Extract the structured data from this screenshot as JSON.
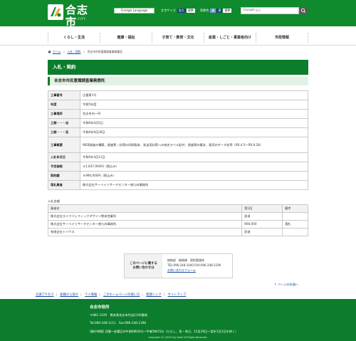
{
  "header": {
    "logo_name": "合志市",
    "logo_sub": "KOSHI CITY",
    "lang_button": "Foreign Language",
    "font_size_label": "文字サイズ",
    "font_enlarge": "拡大",
    "font_standard": "標準",
    "bg_color_label": "背景色",
    "bg_options": [
      "青",
      "黒",
      "標準"
    ],
    "search_brand": "Google",
    "search_placeholder": "提供"
  },
  "nav": {
    "items": [
      {
        "label": "くらし・生活"
      },
      {
        "label": "健康・福祉"
      },
      {
        "label": "子育て・教育・文化"
      },
      {
        "label": "産業・しごと・事業者向け"
      },
      {
        "label": "市政情報"
      }
    ]
  },
  "breadcrumb": {
    "home": "ホーム",
    "parent": "入札・契約",
    "current": "合志市市民意識調査業務委託"
  },
  "section_heading": "入札・契約",
  "page_heading": "合志市市民意識調査業務委託",
  "details": [
    {
      "label": "工事番号",
      "value": "企委第1号"
    },
    {
      "label": "年度",
      "value": "令和5年度"
    },
    {
      "label": "工事場所",
      "value": "合志市内一円"
    },
    {
      "label": "工期・・・自",
      "value": "令和6年4月5日"
    },
    {
      "label": "工期・・・至",
      "value": "令和6年9月28日"
    },
    {
      "label": "工事概要",
      "value": "WEB調査の構築、調査票・封筒の印刷製本、発送用封筒への宛名ラベル貼付、調査票の集計、意見のデータ化等（R6.4.5〜R6.8.28）"
    },
    {
      "label": "入札年月日",
      "value": "令和6年3月11日"
    },
    {
      "label": "予定価格",
      "value": "￥1,837,000円（税込み）"
    },
    {
      "label": "契約額",
      "value": "￥990,000円（税込み）"
    },
    {
      "label": "落札業者",
      "value": "株式会社サーベイリサーチセンター南九州事務所"
    }
  ],
  "bids": {
    "caption": "入札金額",
    "headers": [
      "業者名",
      "第1回",
      "備考"
    ],
    "rows": [
      {
        "name": "株式会社ライフパシフィックデザイン熊本営業所",
        "round1": "辞退",
        "note": ""
      },
      {
        "name": "株式会社サーベイリサーチセンター南九州事務所",
        "round1": "900,000",
        "note": "落札"
      },
      {
        "name": "有限会社トハウス",
        "round1": "辞退",
        "note": ""
      }
    ]
  },
  "contact": {
    "label_line1": "このページに関する",
    "label_line2": "お問い合わせは",
    "dept": "総務部　総務課　契約管理係",
    "tel": "TEL:096-248-1040 FAX:096-248-1196",
    "form_link": "お問い合わせフォーム"
  },
  "page_top": "ページの先頭へ",
  "footer_links": [
    "交通アクセス",
    "組織から探す",
    "个人情報",
    "このホームページの使い方",
    "関連リンク",
    "サイトマップ"
  ],
  "footer": {
    "name": "合志市役所",
    "address": "〒861-1195　熊本県合志市竹迫2140番地",
    "tel": "Tel:096-248-1111　Fax:096-248-1198",
    "hours": "[開庁時間] 月曜〜金曜日の午前8時30分〜午後5時15分（ただし、祝・休日、12月29日〜翌年1月3日を除く）",
    "copyright": "Copyright (C) 2019 City Koshi All Rights Reserved."
  },
  "colors": {
    "brand_green": "#0f8a2c",
    "heading_green": "#0b7d2c",
    "link_blue": "#1a4fa0"
  }
}
